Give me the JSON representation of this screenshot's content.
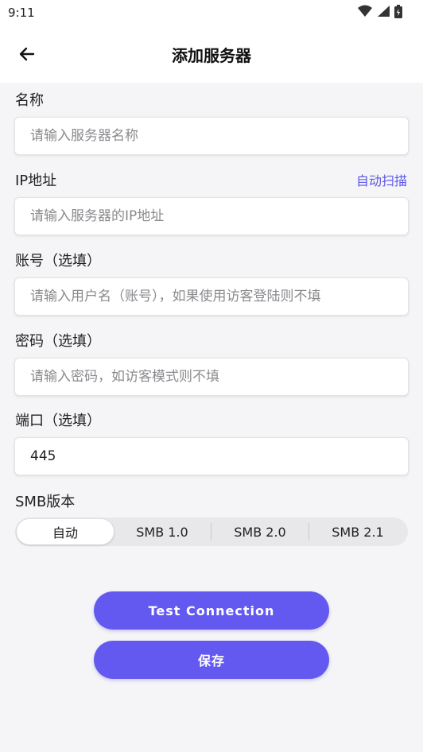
{
  "status_bar": {
    "time": "9:11",
    "icons": [
      "wifi-icon",
      "signal-icon",
      "battery-icon"
    ]
  },
  "app_bar": {
    "title": "添加服务器",
    "back_icon": "arrow-left-icon"
  },
  "form": {
    "name": {
      "label": "名称",
      "placeholder": "请输入服务器名称",
      "value": ""
    },
    "ip": {
      "label": "IP地址",
      "placeholder": "请输入服务器的IP地址",
      "value": "",
      "scan_label": "自动扫描"
    },
    "account": {
      "label": "账号（选填）",
      "placeholder": "请输入用户名（账号），如果使用访客登陆则不填",
      "value": ""
    },
    "password": {
      "label": "密码（选填）",
      "placeholder": "请输入密码，如访客模式则不填",
      "value": ""
    },
    "port": {
      "label": "端口（选填）",
      "placeholder": "",
      "value": "445"
    },
    "smb_version": {
      "label": "SMB版本",
      "options": [
        "自动",
        "SMB 1.0",
        "SMB 2.0",
        "SMB 2.1"
      ],
      "selected": "自动"
    }
  },
  "actions": {
    "test_label": "Test Connection",
    "save_label": "保存"
  },
  "colors": {
    "accent": "#6359f0",
    "link": "#5b55e6",
    "background": "#f5f5f7"
  }
}
